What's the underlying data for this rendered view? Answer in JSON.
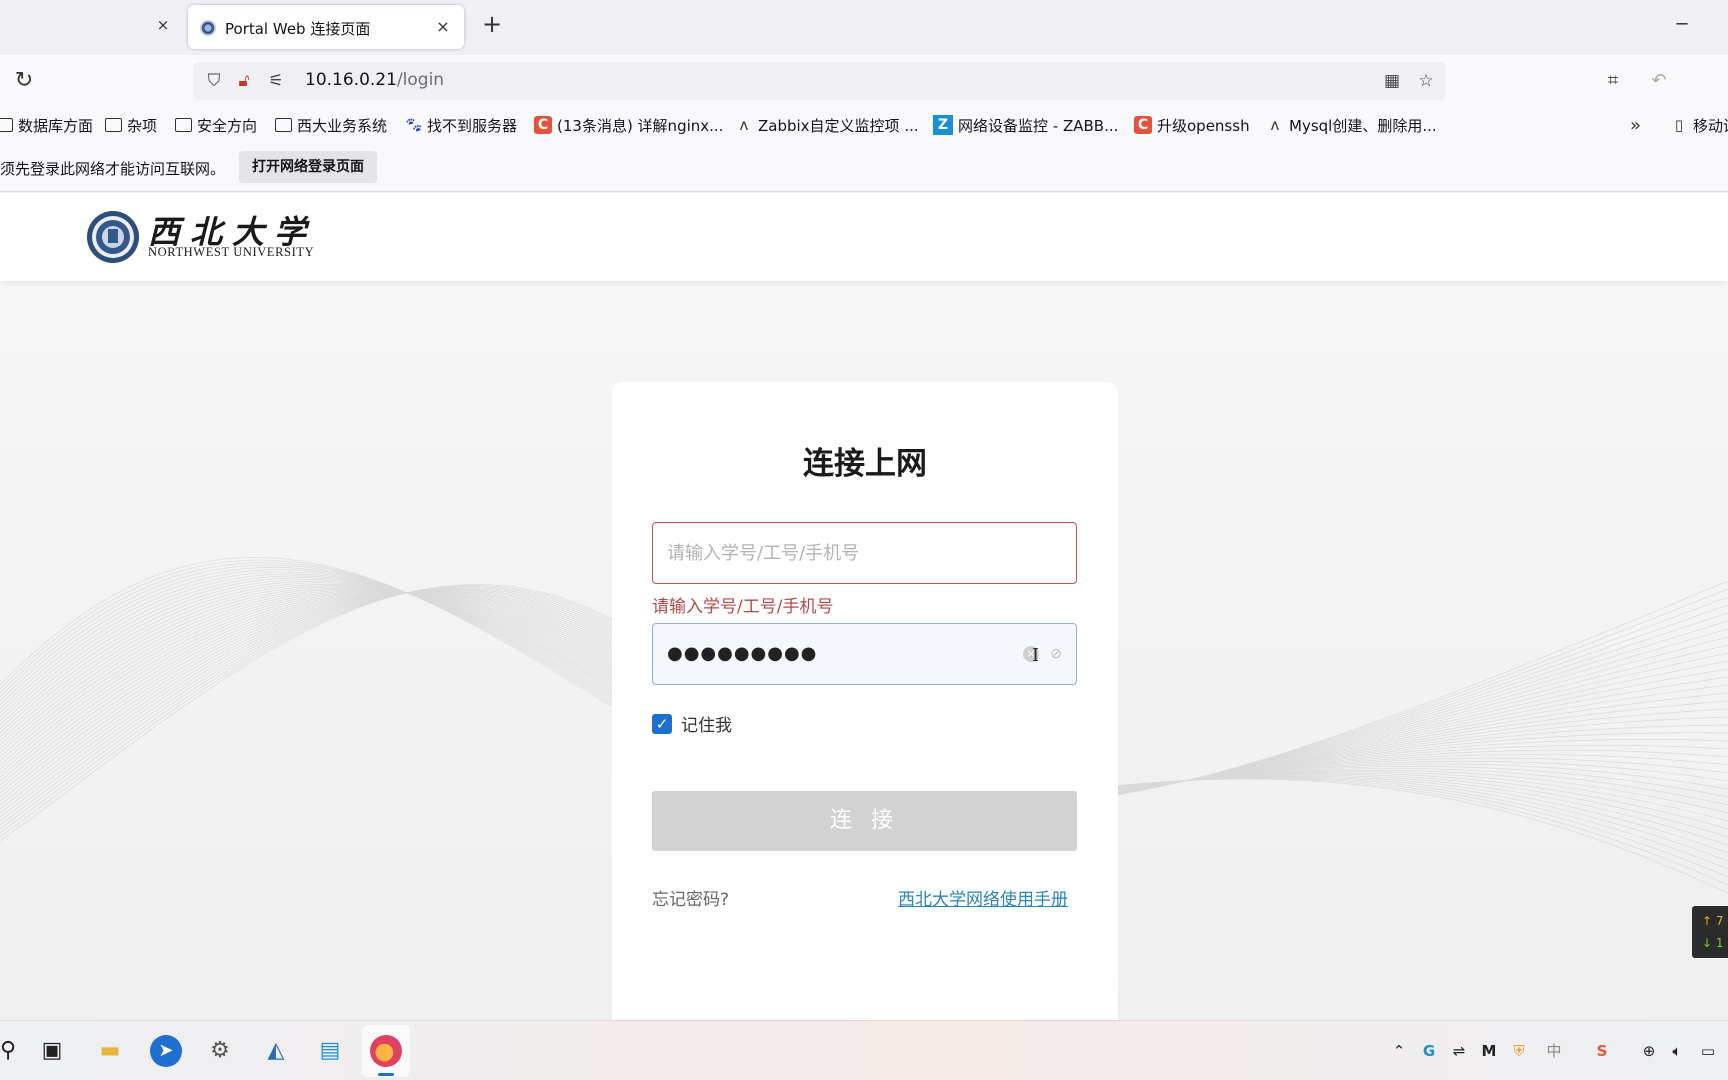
{
  "browser": {
    "tab_title": "Portal Web 连接页面",
    "tab_close": "×",
    "new_tab": "+",
    "minimize": "─",
    "url_host": "10.16.0.21",
    "url_path": "/login"
  },
  "bookmarks": [
    {
      "label": "数据库方面",
      "icon": "folder-icon"
    },
    {
      "label": "杂项",
      "icon": "folder-icon"
    },
    {
      "label": "安全方向",
      "icon": "folder-icon"
    },
    {
      "label": "西大业务系统",
      "icon": "folder-icon"
    },
    {
      "label": "找不到服务器",
      "icon": "paw-icon"
    },
    {
      "label": "(13条消息) 详解nginx...",
      "icon": "csdn-icon"
    },
    {
      "label": "Zabbix自定义监控项 ...",
      "icon": "zabbix-icon"
    },
    {
      "label": "网络设备监控 - ZABB...",
      "icon": "z-icon"
    },
    {
      "label": "升级openssh",
      "icon": "csdn-icon"
    },
    {
      "label": "Mysql创建、删除用...",
      "icon": "zabbix-icon"
    },
    {
      "label": "移动设",
      "icon": "mobile-icon"
    }
  ],
  "notification": {
    "text": "须先登录此网络才能访问互联网。",
    "button": "打开网络登录页面"
  },
  "site": {
    "logo_cn": "西北大学",
    "logo_en": "NORTHWEST UNIVERSITY"
  },
  "login": {
    "title": "连接上网",
    "username_placeholder": "请输入学号/工号/手机号",
    "username_value": "",
    "username_error": "请输入学号/工号/手机号",
    "password_mask": "●●●●●●●●●",
    "remember_label": "记住我",
    "remember_checked": true,
    "connect_button": "连 接",
    "forgot_link": "忘记密码?",
    "manual_link": "西北大学网络使用手册"
  },
  "netspeed": {
    "up": "↑ 7",
    "down": "↓ 1"
  },
  "colors": {
    "error": "#c45656",
    "accent": "#1f6fd1",
    "link": "#2a84b8",
    "button_disabled": "#d2d2d2"
  }
}
